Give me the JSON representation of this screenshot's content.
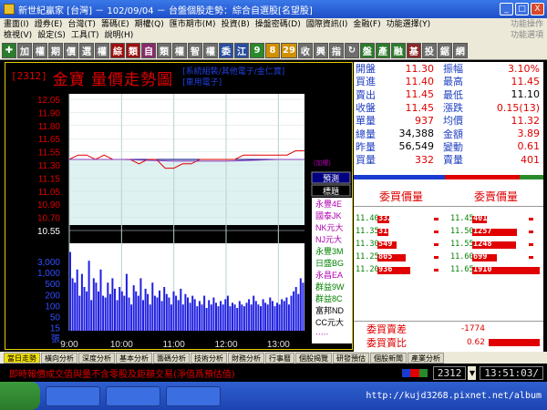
{
  "window": {
    "title": "新世紀贏家 [台灣] － 102/09/04 － 台盤個股走勢：綜合自選股[名望股]",
    "btn_min": "_",
    "btn_max": "□",
    "btn_close": "X"
  },
  "menu": {
    "row1": [
      "畫面(I)",
      "證券(E)",
      "台灣(T)",
      "籌碼(E)",
      "期權(Q)",
      "匯市期市(M)",
      "投資(B)",
      "操盤密碼(D)",
      "國際資訊(I)",
      "金融(F)",
      "功能選擇(Y)"
    ],
    "row1_dim": "功能操作",
    "row2": [
      "檢視(V)",
      "設定(S)",
      "工具(T)",
      "說明(H)"
    ],
    "row2_dim": "功能選項"
  },
  "toolbar": [
    {
      "label": "✚",
      "bg": "#2a7d2a"
    },
    {
      "label": "加",
      "bg": "#6e6e6e"
    },
    {
      "label": "權",
      "bg": "#6e6e6e"
    },
    {
      "label": "期",
      "bg": "#6e6e6e"
    },
    {
      "label": "價",
      "bg": "#6e6e6e"
    },
    {
      "label": "選",
      "bg": "#6e6e6e"
    },
    {
      "label": "權",
      "bg": "#6e6e6e"
    },
    {
      "label": "綜",
      "bg": "#a01010"
    },
    {
      "label": "類",
      "bg": "#a01010"
    },
    {
      "label": "自",
      "bg": "#8a2a6a"
    },
    {
      "label": "類",
      "bg": "#6e6e6e"
    },
    {
      "label": "權",
      "bg": "#6e6e6e"
    },
    {
      "label": "智",
      "bg": "#6e6e6e"
    },
    {
      "label": "權",
      "bg": "#6e6e6e"
    },
    {
      "label": "委",
      "bg": "#2a4fa0"
    },
    {
      "label": "江",
      "bg": "#2a4fa0"
    },
    {
      "label": "9",
      "bg": "#2a8a2a"
    },
    {
      "label": "8",
      "bg": "#d09000"
    },
    {
      "label": "29",
      "bg": "#d09000"
    },
    {
      "label": "收",
      "bg": "#6e6e6e"
    },
    {
      "label": "興",
      "bg": "#6e6e6e"
    },
    {
      "label": "指",
      "bg": "#6e6e6e"
    },
    {
      "label": "↻",
      "bg": "#6e6e6e"
    },
    {
      "label": "盤",
      "bg": "#2a7d2a"
    },
    {
      "label": "產",
      "bg": "#2a7d2a"
    },
    {
      "label": "融",
      "bg": "#2a7d2a"
    },
    {
      "label": "基",
      "bg": "#8a2a2a"
    },
    {
      "label": "投",
      "bg": "#6e6e6e"
    },
    {
      "label": "鋸",
      "bg": "#6e6e6e"
    },
    {
      "label": "網",
      "bg": "#6e6e6e"
    }
  ],
  "chart": {
    "code": "[2312]",
    "name": "金寶  量價走勢圖",
    "categories_line1": "[系統組裝/其他電子/金仁寶]",
    "categories_line2": "[車用電子]",
    "legend_change": "(加權)",
    "indicator_buttons": [
      "預測",
      "標題"
    ],
    "broker_list": [
      {
        "label": "永豐4E",
        "color": "#b000b0"
      },
      {
        "label": "國泰JK",
        "color": "#b000b0"
      },
      {
        "label": "NK元大",
        "color": "#b000b0"
      },
      {
        "label": "NJ元大",
        "color": "#b000b0"
      },
      {
        "label": "永豐3M",
        "color": "#008000"
      },
      {
        "label": "日盛BG",
        "color": "#008000"
      },
      {
        "label": "永昌EA",
        "color": "#b000b0"
      },
      {
        "label": "群益9W",
        "color": "#008000"
      },
      {
        "label": "群益8C",
        "color": "#008000"
      },
      {
        "label": "富邦ND",
        "color": "#000000"
      },
      {
        "label": "CC元大",
        "color": "#000000"
      },
      {
        "label": "‧‧‧‧‧",
        "color": "#b000b0"
      }
    ]
  },
  "chart_data": {
    "type": "line",
    "price_ticks": [
      "12.05",
      "11.90",
      "11.80",
      "11.65",
      "11.55",
      "11.30",
      "11.15",
      "11.05",
      "10.90",
      "10.70",
      "10.55"
    ],
    "price_ylim": [
      10.55,
      12.05
    ],
    "reference_price": 11.3,
    "volume_ticks": [
      "3,000",
      "1,000",
      "500",
      "200",
      "100",
      "50",
      "15",
      "張"
    ],
    "x_ticks": [
      "9:00",
      "10:00",
      "11:00",
      "12:00",
      "13:00"
    ],
    "xlim": [
      "9:00",
      "13:30"
    ],
    "price_series": [
      {
        "t": 0,
        "p": 11.3
      },
      {
        "t": 10,
        "p": 11.35
      },
      {
        "t": 20,
        "p": 11.35
      },
      {
        "t": 30,
        "p": 11.3
      },
      {
        "t": 40,
        "p": 11.35
      },
      {
        "t": 50,
        "p": 11.3
      },
      {
        "t": 60,
        "p": 11.3
      },
      {
        "t": 70,
        "p": 11.3
      },
      {
        "t": 80,
        "p": 11.25
      },
      {
        "t": 90,
        "p": 11.3
      },
      {
        "t": 100,
        "p": 11.3
      },
      {
        "t": 110,
        "p": 11.2
      },
      {
        "t": 120,
        "p": 11.2
      },
      {
        "t": 130,
        "p": 11.25
      },
      {
        "t": 140,
        "p": 11.25
      },
      {
        "t": 150,
        "p": 11.3
      },
      {
        "t": 160,
        "p": 11.3
      },
      {
        "t": 170,
        "p": 11.3
      },
      {
        "t": 180,
        "p": 11.3
      },
      {
        "t": 190,
        "p": 11.3
      },
      {
        "t": 200,
        "p": 11.35
      },
      {
        "t": 210,
        "p": 11.35
      },
      {
        "t": 220,
        "p": 11.35
      },
      {
        "t": 230,
        "p": 11.35
      },
      {
        "t": 240,
        "p": 11.35
      },
      {
        "t": 250,
        "p": 11.35
      },
      {
        "t": 260,
        "p": 11.4
      },
      {
        "t": 270,
        "p": 11.4
      }
    ],
    "avg_series": [
      {
        "t": 0,
        "p": 11.3
      },
      {
        "t": 60,
        "p": 11.3
      },
      {
        "t": 120,
        "p": 11.28
      },
      {
        "t": 180,
        "p": 11.28
      },
      {
        "t": 240,
        "p": 11.3
      },
      {
        "t": 270,
        "p": 11.3
      }
    ],
    "volume_series": [
      90,
      60,
      55,
      70,
      40,
      65,
      50,
      45,
      80,
      35,
      60,
      55,
      45,
      70,
      40,
      38,
      55,
      42,
      60,
      48,
      35,
      50,
      45,
      40,
      65,
      38,
      30,
      52,
      45,
      40,
      60,
      35,
      48,
      42,
      30,
      55,
      40,
      38,
      46,
      34,
      50,
      42,
      38,
      30,
      45,
      40,
      35,
      48,
      30,
      42,
      38,
      32,
      40,
      36,
      28,
      34,
      30,
      40,
      26,
      35,
      30,
      38,
      32,
      28,
      34,
      30,
      36,
      40,
      28,
      32,
      30,
      26,
      34,
      30,
      28,
      32,
      36,
      30,
      40,
      34,
      30,
      28,
      36,
      32,
      30,
      38,
      34,
      28,
      32,
      30,
      36,
      34,
      38,
      30,
      40,
      45,
      50,
      42,
      60,
      55
    ],
    "volume_ylim": [
      0,
      100
    ]
  },
  "quote": {
    "rows": [
      {
        "l1": "開盤",
        "v1": "11.30",
        "c1": "red",
        "l2": "振幅",
        "v2": "3.10%",
        "c2": "red"
      },
      {
        "l1": "買進",
        "v1": "11.40",
        "c1": "red",
        "l2": "最高",
        "v2": "11.45",
        "c2": "red"
      },
      {
        "l1": "賣出",
        "v1": "11.45",
        "c1": "red",
        "l2": "最低",
        "v2": "11.10",
        "c2": "blk"
      },
      {
        "l1": "收盤",
        "v1": "11.45",
        "c1": "red",
        "l2": "漲跌",
        "v2": "0.15(13)",
        "c2": "red"
      },
      {
        "l1": "單量",
        "v1": "937",
        "c1": "red",
        "l2": "均價",
        "v2": "11.32",
        "c2": "red"
      },
      {
        "l1": "總量",
        "v1": "34,388",
        "c1": "blk",
        "l2": "金額",
        "v2": "3.89",
        "c2": "red"
      },
      {
        "l1": "昨量",
        "v1": "56,549",
        "c1": "blk",
        "l2": "變動",
        "v2": "0.61",
        "c2": "red"
      },
      {
        "l1": "買量",
        "v1": "332",
        "c1": "red",
        "l2": "賣量",
        "v2": "401",
        "c2": "red"
      }
    ]
  },
  "orderbook": {
    "bid_header": "委買價量",
    "ask_header": "委賣價量",
    "bids": [
      {
        "price": "11.40",
        "qty": "332",
        "ratio": 0.17
      },
      {
        "price": "11.35",
        "qty": "315",
        "ratio": 0.16
      },
      {
        "price": "11.30",
        "qty": "549",
        "ratio": 0.29
      },
      {
        "price": "11.25",
        "qty": "805",
        "ratio": 0.42
      },
      {
        "price": "11.20",
        "qty": "936",
        "ratio": 0.49
      }
    ],
    "asks": [
      {
        "price": "11.45",
        "qty": "401",
        "ratio": 0.21
      },
      {
        "price": "11.50",
        "qty": "1257",
        "ratio": 0.66
      },
      {
        "price": "11.55",
        "qty": "1248",
        "ratio": 0.65
      },
      {
        "price": "11.60",
        "qty": "699",
        "ratio": 0.37
      },
      {
        "price": "11.65",
        "qty": "1910",
        "ratio": 1.0
      }
    ],
    "diff_label": "委買賣差",
    "diff_value": "-1774",
    "ratio_label": "委買賣比",
    "ratio_value": "0.62",
    "ratio_fill": 0.62
  },
  "tabs": [
    "當日走勢",
    "橫向分析",
    "深度分析",
    "基本分析",
    "籌碼分析",
    "技術分析",
    "財務分析",
    "行事曆",
    "個股揭覽",
    "研發預估",
    "個股新聞",
    "產業分析"
  ],
  "status": {
    "message": "即時報價成交值與量不含零股及鉅額交易(淨值爲預估值)",
    "code": "2312",
    "time": "13:51:03/"
  },
  "taskbar": {
    "watermark": "http://kujd3268.pixnet.net/album"
  },
  "colors": {
    "up": "#e00000",
    "down": "#008000",
    "chart_bg": "#000000",
    "plot_bg": "#ffffff",
    "volume": "#2020e0"
  }
}
